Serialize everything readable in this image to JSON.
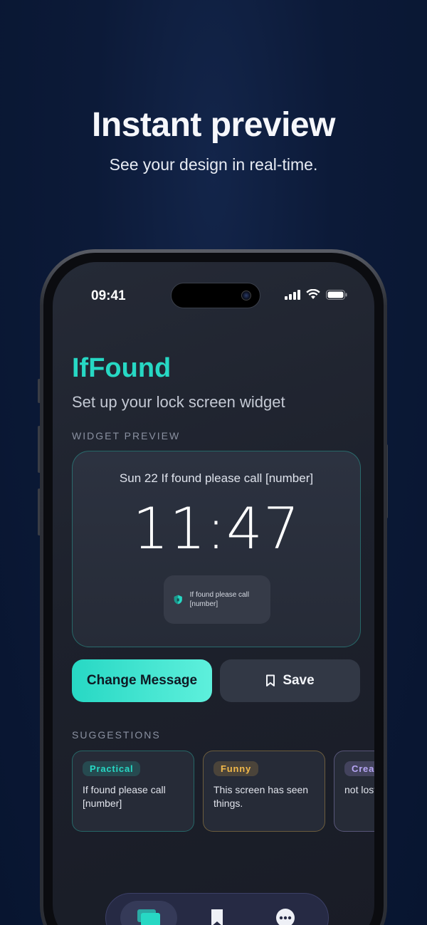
{
  "hero": {
    "title": "Instant preview",
    "subtitle": "See your design in real-time."
  },
  "status_bar": {
    "time": "09:41",
    "icons": [
      "signal-icon",
      "wifi-icon",
      "battery-icon"
    ]
  },
  "app": {
    "title": "IfFound",
    "subtitle": "Set up your lock screen widget",
    "accent_color": "#27d8c4"
  },
  "widget_preview": {
    "section_label": "WIDGET PREVIEW",
    "top_line": "Sun 22 If found please call [number]",
    "clock": "11:47",
    "mini_widget_icon": "shield-icon",
    "mini_widget_text": "If found please call [number]"
  },
  "actions": {
    "change_label": "Change Message",
    "save_label": "Save",
    "save_icon": "bookmark-icon"
  },
  "suggestions": {
    "section_label": "SUGGESTIONS",
    "items": [
      {
        "tag": "Practical",
        "text": "If found please call [number]",
        "tag_color": "#27d8c4"
      },
      {
        "tag": "Funny",
        "text": "This screen has seen things.",
        "tag_color": "#f2b94a"
      },
      {
        "tag": "Creat",
        "text": "not lost exploring",
        "tag_color": "#b7a6f5"
      }
    ]
  },
  "tab_bar": {
    "items": [
      {
        "icon": "cards-icon",
        "active": true
      },
      {
        "icon": "bookmark-icon",
        "active": false
      },
      {
        "icon": "more-icon",
        "active": false
      }
    ]
  }
}
